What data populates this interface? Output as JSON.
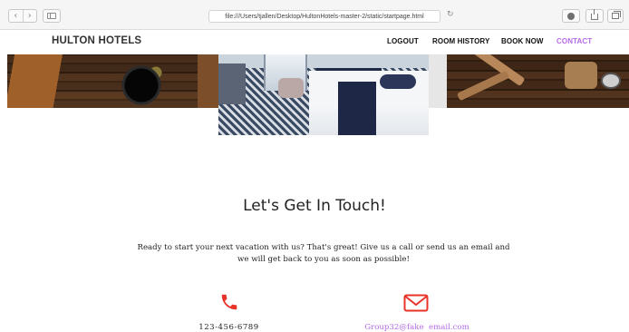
{
  "browser": {
    "url": "file:///Users/tjallen/Desktop/HultonHotels-master-2/static/startpage.html",
    "back_icon": "chevron-left-icon",
    "forward_icon": "chevron-right-icon",
    "back_glyph": "‹",
    "forward_glyph": "›",
    "reload_glyph": "↻"
  },
  "header": {
    "brand": "HULTON HOTELS",
    "nav": {
      "logout": "LOGOUT",
      "room_history": "ROOM HISTORY",
      "book_now": "BOOK NOW",
      "contact": "CONTACT"
    },
    "active_color": "#b46be6"
  },
  "contact": {
    "title": "Let's Get In Touch!",
    "text": "Ready to start your next vacation with us? That's great! Give us a call or send us an email and we will get back to you as soon as possible!",
    "phone": "123-456-6789",
    "email": "Group32@fake  email.com",
    "icon_color": "#e8332a"
  }
}
